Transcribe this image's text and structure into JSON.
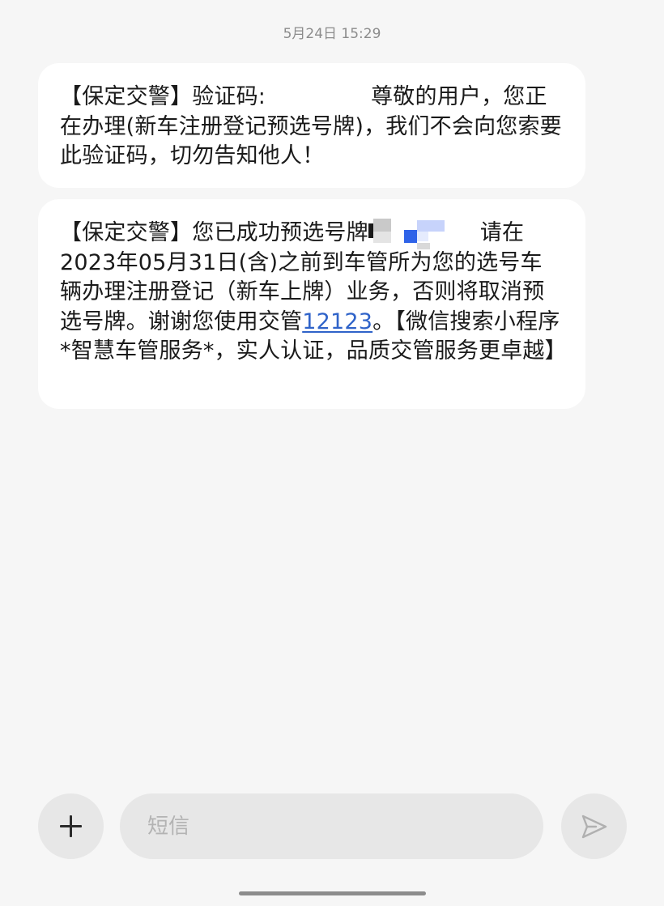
{
  "conversation": {
    "timestamp": "5月24日 15:29",
    "messages": [
      {
        "prefix": "【保定交警】验证码:",
        "body": "尊敬的用户，您正在办理(新车注册登记预选号牌)，我们不会向您索要此验证码，切勿告知他人！"
      },
      {
        "prefix": "【保定交警】您已成功预选号牌",
        "body_before_link": "请在2023年05月31日(含)之前到车管所为您的选号车辆办理注册登记（新车上牌）业务，否则将取消预选号牌。谢谢您使用交管",
        "link_text": "12123",
        "body_after_link": "。【微信搜索小程序*智慧车管服务*，实人认证，品质交管服务更卓越】"
      }
    ]
  },
  "composer": {
    "placeholder": "短信",
    "value": "",
    "add_icon": "plus-icon",
    "send_icon": "send-icon"
  }
}
